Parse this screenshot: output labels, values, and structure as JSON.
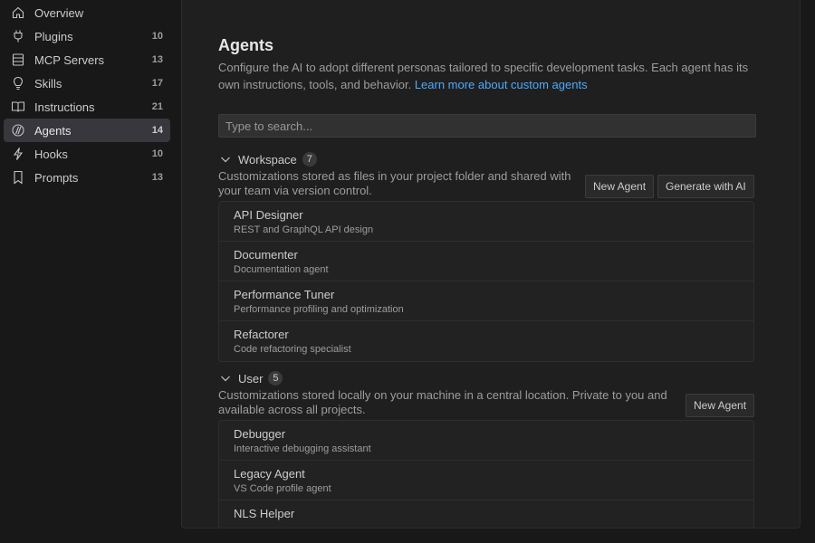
{
  "sidebar": {
    "items": [
      {
        "label": "Overview",
        "count": "",
        "icon": "home-icon"
      },
      {
        "label": "Plugins",
        "count": "10",
        "icon": "plug-icon"
      },
      {
        "label": "MCP Servers",
        "count": "13",
        "icon": "server-icon"
      },
      {
        "label": "Skills",
        "count": "17",
        "icon": "lightbulb-icon"
      },
      {
        "label": "Instructions",
        "count": "21",
        "icon": "book-icon"
      },
      {
        "label": "Agents",
        "count": "14",
        "icon": "agent-icon"
      },
      {
        "label": "Hooks",
        "count": "10",
        "icon": "lightning-icon"
      },
      {
        "label": "Prompts",
        "count": "13",
        "icon": "bookmark-icon"
      }
    ],
    "active": "Agents"
  },
  "main": {
    "title": "Agents",
    "description": "Configure the AI to adopt different personas tailored to specific development tasks. Each agent has its own instructions, tools, and behavior.",
    "learn_more": "Learn more about custom agents",
    "search_placeholder": "Type to search..."
  },
  "workspace": {
    "title": "Workspace",
    "count": "7",
    "description": "Customizations stored as files in your project folder and shared with your team via version control.",
    "new_agent_label": "New Agent",
    "generate_label": "Generate with AI",
    "items": [
      {
        "name": "API Designer",
        "desc": "REST and GraphQL API design"
      },
      {
        "name": "Documenter",
        "desc": "Documentation agent"
      },
      {
        "name": "Performance Tuner",
        "desc": "Performance profiling and optimization"
      },
      {
        "name": "Refactorer",
        "desc": "Code refactoring specialist"
      }
    ]
  },
  "user": {
    "title": "User",
    "count": "5",
    "description": "Customizations stored locally on your machine in a central location. Private to you and available across all projects.",
    "new_agent_label": "New Agent",
    "items": [
      {
        "name": "Debugger",
        "desc": "Interactive debugging assistant"
      },
      {
        "name": "Legacy Agent",
        "desc": "VS Code profile agent"
      },
      {
        "name": "NLS Helper",
        "desc": ""
      }
    ]
  },
  "colors": {
    "accent_link": "#4daafc",
    "active_bg": "#37373d",
    "panel_bg": "#1f1f1f",
    "sidebar_bg": "#181818"
  }
}
